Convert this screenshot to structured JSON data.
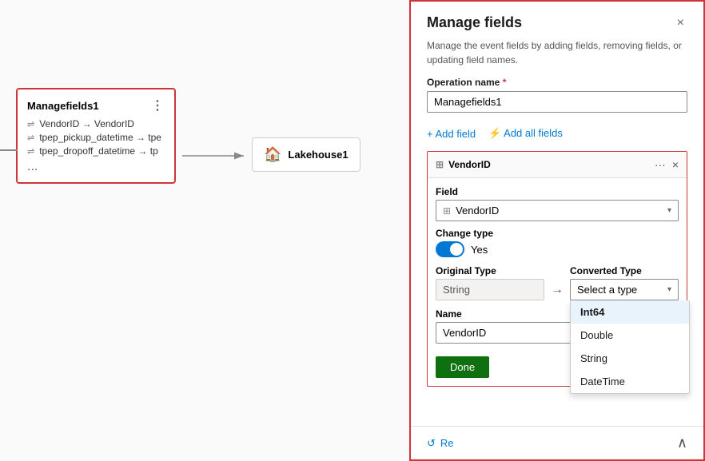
{
  "canvas": {
    "managefields_node": {
      "title": "Managefields1",
      "rows": [
        "VendorID → VendorID",
        "tpep_pickup_datetime → tpe",
        "tpep_dropoff_datetime → tp"
      ],
      "ellipsis": "..."
    },
    "lakehouse_node": {
      "title": "Lakehouse1"
    }
  },
  "panel": {
    "title": "Manage fields",
    "description": "Manage the event fields by adding fields, removing fields, or updating field names.",
    "close_label": "×",
    "operation_name_label": "Operation name",
    "operation_name_value": "Managefields1",
    "add_field_label": "+ Add field",
    "add_all_fields_label": "⚡ Add all fields",
    "vendor_id_card": {
      "title": "VendorID",
      "field_label": "Field",
      "field_value": "VendorID",
      "change_type_label": "Change type",
      "change_type_toggle_on": true,
      "toggle_yes_label": "Yes",
      "original_type_label": "Original Type",
      "original_type_value": "String",
      "converted_type_label": "Converted Type",
      "converted_type_placeholder": "Select a type",
      "name_label": "Name",
      "name_value": "VendorID",
      "done_label": "Done",
      "dropdown_items": [
        {
          "label": "Int64",
          "selected": false
        },
        {
          "label": "Double",
          "selected": false
        },
        {
          "label": "String",
          "selected": false
        },
        {
          "label": "DateTime",
          "selected": false
        }
      ]
    },
    "footer": {
      "reset_label": "Re"
    }
  }
}
